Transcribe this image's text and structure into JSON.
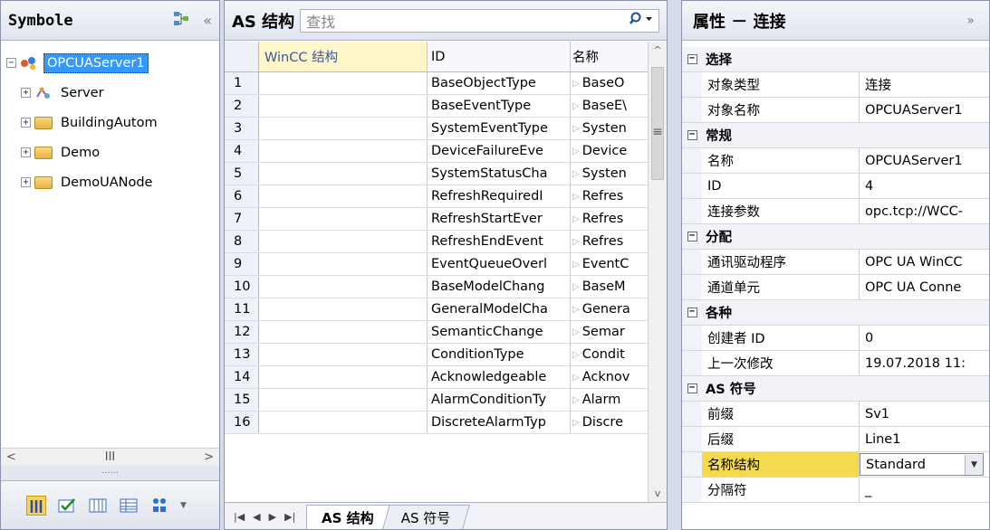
{
  "left": {
    "title": "Symbole",
    "collapse_label": "«",
    "tree": [
      {
        "label": "OPCUAServer1",
        "expander": "−",
        "level": 0,
        "selected": true
      },
      {
        "label": "Server",
        "expander": "+",
        "level": 1
      },
      {
        "label": "BuildingAutom",
        "expander": "+",
        "level": 1
      },
      {
        "label": "Demo",
        "expander": "+",
        "level": 1
      },
      {
        "label": "DemoUANode",
        "expander": "+",
        "level": 1
      }
    ],
    "hscroll": {
      "left": "<",
      "middle": "III",
      "right": ">"
    },
    "grip": "......"
  },
  "center": {
    "title": "AS 结构",
    "search_placeholder": "查找",
    "search_icon": "search-icon",
    "columns": {
      "wincc": "WinCC 结构",
      "id": "ID",
      "name": "名称"
    },
    "rows": [
      {
        "num": "1",
        "id": "BaseObjectType",
        "name": "BaseO"
      },
      {
        "num": "2",
        "id": "BaseEventType",
        "name": "BaseE\\"
      },
      {
        "num": "3",
        "id": "SystemEventType",
        "name": "Systen"
      },
      {
        "num": "4",
        "id": "DeviceFailureEve",
        "name": "Device"
      },
      {
        "num": "5",
        "id": "SystemStatusCha",
        "name": "Systen"
      },
      {
        "num": "6",
        "id": "RefreshRequiredI",
        "name": "Refres"
      },
      {
        "num": "7",
        "id": "RefreshStartEver",
        "name": "Refres"
      },
      {
        "num": "8",
        "id": "RefreshEndEvent",
        "name": "Refres"
      },
      {
        "num": "9",
        "id": "EventQueueOverl",
        "name": "EventC"
      },
      {
        "num": "10",
        "id": "BaseModelChang",
        "name": "BaseM"
      },
      {
        "num": "11",
        "id": "GeneralModelCha",
        "name": "Genera"
      },
      {
        "num": "12",
        "id": "SemanticChange",
        "name": "Semar"
      },
      {
        "num": "13",
        "id": "ConditionType",
        "name": "Condit"
      },
      {
        "num": "14",
        "id": "Acknowledgeable",
        "name": "Acknov"
      },
      {
        "num": "15",
        "id": "AlarmConditionTy",
        "name": "Alarm"
      },
      {
        "num": "16",
        "id": "DiscreteAlarmTyp",
        "name": "Discre"
      }
    ],
    "tabs": {
      "active": "AS 结构",
      "inactive": "AS 符号"
    },
    "nav": [
      "|◀",
      "◀",
      "▶",
      "▶|"
    ]
  },
  "right": {
    "title": "属性 － 连接",
    "expand_label": "»",
    "categories": [
      {
        "label": "选择",
        "items": [
          {
            "name": "对象类型",
            "value": "连接"
          },
          {
            "name": "对象名称",
            "value": "OPCUAServer1"
          }
        ]
      },
      {
        "label": "常规",
        "items": [
          {
            "name": "名称",
            "value": "OPCUAServer1"
          },
          {
            "name": "ID",
            "value": "4"
          },
          {
            "name": "连接参数",
            "value": "opc.tcp://WCC-"
          }
        ]
      },
      {
        "label": "分配",
        "items": [
          {
            "name": "通讯驱动程序",
            "value": "OPC UA WinCC"
          },
          {
            "name": "通道单元",
            "value": "OPC UA Conne"
          }
        ]
      },
      {
        "label": "各种",
        "items": [
          {
            "name": "创建者 ID",
            "value": "0"
          },
          {
            "name": "上一次修改",
            "value": "19.07.2018 11:"
          }
        ]
      },
      {
        "label": "AS 符号",
        "items": [
          {
            "name": "前缀",
            "value": "Sv1"
          },
          {
            "name": "后缀",
            "value": "Line1"
          },
          {
            "name": "名称结构",
            "value": "Standard"
          },
          {
            "name": "分隔符",
            "value": "_"
          }
        ]
      }
    ]
  },
  "colors": {
    "selection": "#3399ff",
    "highlight": "#f5d94e",
    "header_accent": "#fff7c9"
  }
}
